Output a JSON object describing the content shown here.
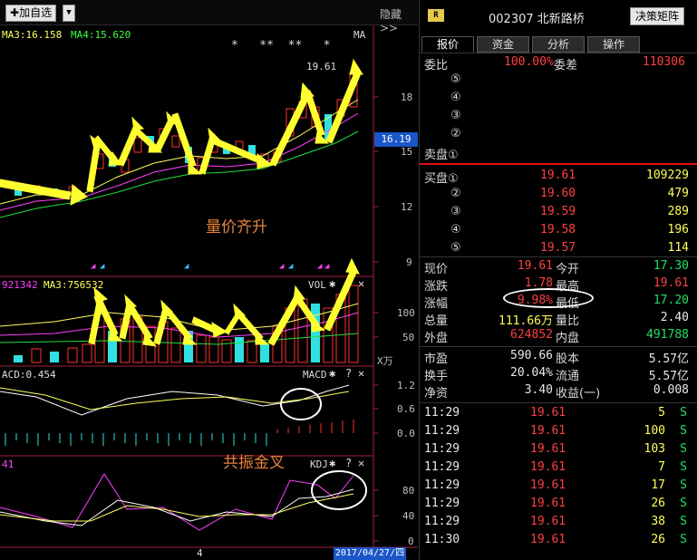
{
  "toolbar": {
    "add_label": "加自选",
    "add_icon": "plus-icon",
    "drop_icon": "chevron-down-icon",
    "hide_label": "隐藏>>"
  },
  "main_chart": {
    "ma3": "MA3:16.158",
    "ma4": "MA4:15.620",
    "ma_tag": "MA",
    "stars": "*   **  **   *",
    "peak_label": "19.61",
    "price_axis": [
      "18",
      "15",
      "12",
      "9"
    ],
    "current_price": "16.19",
    "annotation": "量价齐升"
  },
  "vol_chart": {
    "ma_left": "921342",
    "ma3": "MA3:756532",
    "label": "VOL",
    "axis": [
      "100",
      "50"
    ],
    "unit": "X万"
  },
  "macd_chart": {
    "value": "ACD:0.454",
    "label": "MACD",
    "axis": [
      "1.2",
      "0.6",
      "0.0"
    ],
    "annotation": "共振金叉"
  },
  "kdj_chart": {
    "value": "41",
    "label": "KDJ",
    "axis": [
      "80",
      "40",
      "0"
    ]
  },
  "bottom": {
    "page_num": "4",
    "date": "2017/04/27/四"
  },
  "quote": {
    "badge": "R",
    "code": "002307",
    "name": "北新路桥",
    "decide_btn": "决策矩阵",
    "tabs": [
      "报价",
      "资金",
      "分析",
      "操作"
    ],
    "webi_label": "委比",
    "webi": "100.00%",
    "weicha_label": "委差",
    "weicha": "110306",
    "sell": [
      {
        "lvl": "⑤"
      },
      {
        "lvl": "④"
      },
      {
        "lvl": "③"
      },
      {
        "lvl": "②"
      },
      {
        "lvl": "卖盘①"
      }
    ],
    "buy": [
      {
        "lvl": "买盘①",
        "price": "19.61",
        "vol": "109229"
      },
      {
        "lvl": "②",
        "price": "19.60",
        "vol": "479"
      },
      {
        "lvl": "③",
        "price": "19.59",
        "vol": "289"
      },
      {
        "lvl": "④",
        "price": "19.58",
        "vol": "196"
      },
      {
        "lvl": "⑤",
        "price": "19.57",
        "vol": "114"
      }
    ],
    "stats": [
      {
        "l1": "现价",
        "v1": "19.61",
        "l2": "今开",
        "v2": "17.30"
      },
      {
        "l1": "涨跌",
        "v1": "1.78",
        "l2": "最高",
        "v2": "19.61"
      },
      {
        "l1": "涨幅",
        "v1": "9.98%",
        "l2": "最低",
        "v2": "17.20"
      },
      {
        "l1": "总量",
        "v1": "111.66万",
        "l2": "量比",
        "v2": "2.40"
      },
      {
        "l1": "外盘",
        "v1": "624852",
        "l2": "内盘",
        "v2": "491788"
      }
    ],
    "fund": [
      {
        "l1": "市盈",
        "v1": "590.66",
        "l2": "股本",
        "v2": "5.57亿"
      },
      {
        "l1": "换手",
        "v1": "20.04%",
        "l2": "流通",
        "v2": "5.57亿"
      },
      {
        "l1": "净资",
        "v1": "3.40",
        "l2": "收益(一)",
        "v2": "0.008"
      }
    ],
    "ticks": [
      {
        "t": "11:29",
        "p": "19.61",
        "v": "5",
        "s": "S"
      },
      {
        "t": "11:29",
        "p": "19.61",
        "v": "100",
        "s": "S"
      },
      {
        "t": "11:29",
        "p": "19.61",
        "v": "103",
        "s": "S"
      },
      {
        "t": "11:29",
        "p": "19.61",
        "v": "7",
        "s": "S"
      },
      {
        "t": "11:29",
        "p": "19.61",
        "v": "17",
        "s": "S"
      },
      {
        "t": "11:29",
        "p": "19.61",
        "v": "26",
        "s": "S"
      },
      {
        "t": "11:29",
        "p": "19.61",
        "v": "38",
        "s": "S"
      },
      {
        "t": "11:30",
        "p": "19.61",
        "v": "26",
        "s": "S"
      }
    ]
  }
}
